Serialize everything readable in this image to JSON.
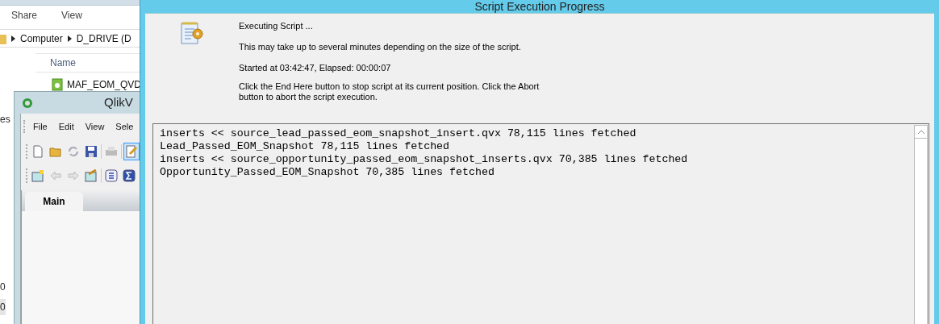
{
  "explorer": {
    "ribbon_tabs": [
      "Share",
      "View"
    ],
    "breadcrumb": [
      "Computer",
      "D_DRIVE (D"
    ],
    "column_header": "Name",
    "files": [
      "MAF_EOM_QVD"
    ],
    "nav_items": [
      {
        "text": "es",
        "selected": false
      },
      {
        "text": "0",
        "selected": false
      },
      {
        "text": "0",
        "selected": true
      }
    ]
  },
  "qlikview": {
    "title": "QlikV",
    "menu": [
      "File",
      "Edit",
      "View",
      "Sele"
    ],
    "toolbar_rows": [
      [
        {
          "kind": "new",
          "selected": false
        },
        {
          "kind": "open",
          "selected": false
        },
        {
          "kind": "reload",
          "selected": false
        },
        {
          "kind": "save",
          "selected": false
        },
        {
          "kind": "sep"
        },
        {
          "kind": "print",
          "selected": false
        },
        {
          "kind": "sep"
        },
        {
          "kind": "edit",
          "selected": true
        }
      ],
      [
        {
          "kind": "newsheet",
          "selected": false
        },
        {
          "kind": "back",
          "selected": false
        },
        {
          "kind": "forward",
          "selected": false
        },
        {
          "kind": "sheetprops",
          "selected": false
        },
        {
          "kind": "sep"
        },
        {
          "kind": "list",
          "selected": false
        },
        {
          "kind": "sum",
          "selected": false
        }
      ]
    ],
    "sheet_tabs": [
      {
        "label": "Main",
        "selected": true
      }
    ]
  },
  "dialog": {
    "title": "Script Execution Progress",
    "messages": [
      "Executing Script ...",
      "This may take up to several minutes depending on the size of the script.",
      "Started at 03:42:47, Elapsed: 00:00:07",
      "Click the End Here button to stop script at its current position. Click the Abort button to abort the script execution."
    ],
    "log_lines": [
      "inserts << source_lead_passed_eom_snapshot_insert.qvx 78,115 lines fetched",
      "Lead_Passed_EOM_Snapshot 78,115 lines fetched",
      "inserts << source_opportunity_passed_eom_snapshot_inserts.qvx 70,385 lines fetched",
      "Opportunity_Passed_EOM_Snapshot 70,385 lines fetched"
    ]
  }
}
